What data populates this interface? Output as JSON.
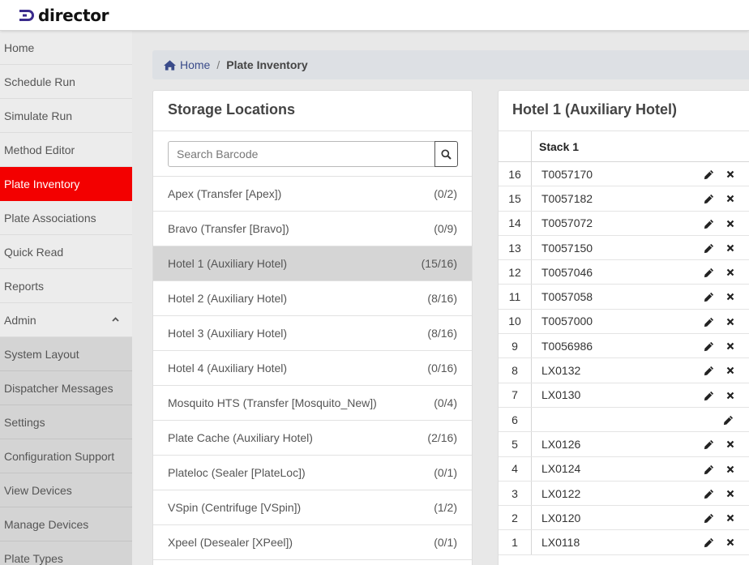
{
  "app": {
    "logo_text": "director"
  },
  "sidebar": {
    "items": [
      {
        "label": "Home",
        "state": "normal"
      },
      {
        "label": "Schedule Run",
        "state": "normal"
      },
      {
        "label": "Simulate Run",
        "state": "normal"
      },
      {
        "label": "Method Editor",
        "state": "normal"
      },
      {
        "label": "Plate Inventory",
        "state": "active"
      },
      {
        "label": "Plate Associations",
        "state": "normal"
      },
      {
        "label": "Quick Read",
        "state": "normal"
      },
      {
        "label": "Reports",
        "state": "normal"
      },
      {
        "label": "Admin",
        "state": "normal",
        "icon": "chevron-up-icon"
      },
      {
        "label": "System Layout",
        "state": "sub"
      },
      {
        "label": "Dispatcher Messages",
        "state": "sub"
      },
      {
        "label": "Settings",
        "state": "sub"
      },
      {
        "label": "Configuration Support",
        "state": "sub"
      },
      {
        "label": "View Devices",
        "state": "sub"
      },
      {
        "label": "Manage Devices",
        "state": "sub"
      },
      {
        "label": "Plate Types",
        "state": "sub"
      }
    ]
  },
  "breadcrumb": {
    "home_label": "Home",
    "separator": "/",
    "current": "Plate Inventory",
    "home_icon": "home-icon"
  },
  "storage": {
    "title": "Storage Locations",
    "search_placeholder": "Search Barcode",
    "search_value": "",
    "search_icon": "search-icon",
    "locations": [
      {
        "name": "Apex (Transfer [Apex])",
        "count": "(0/2)"
      },
      {
        "name": "Bravo (Transfer [Bravo])",
        "count": "(0/9)"
      },
      {
        "name": "Hotel 1 (Auxiliary Hotel)",
        "count": "(15/16)",
        "selected": true
      },
      {
        "name": "Hotel 2 (Auxiliary Hotel)",
        "count": "(8/16)"
      },
      {
        "name": "Hotel 3 (Auxiliary Hotel)",
        "count": "(8/16)"
      },
      {
        "name": "Hotel 4 (Auxiliary Hotel)",
        "count": "(0/16)"
      },
      {
        "name": "Mosquito HTS (Transfer [Mosquito_New])",
        "count": "(0/4)"
      },
      {
        "name": "Plate Cache (Auxiliary Hotel)",
        "count": "(2/16)"
      },
      {
        "name": "Plateloc (Sealer [PlateLoc])",
        "count": "(0/1)"
      },
      {
        "name": "VSpin (Centrifuge [VSpin])",
        "count": "(1/2)"
      },
      {
        "name": "Xpeel (Desealer [XPeel])",
        "count": "(0/1)"
      }
    ]
  },
  "hotel": {
    "title": "Hotel 1 (Auxiliary Hotel)",
    "stack_header": "Stack 1",
    "rows": [
      {
        "num": "16",
        "barcode": "T0057170"
      },
      {
        "num": "15",
        "barcode": "T0057182"
      },
      {
        "num": "14",
        "barcode": "T0057072"
      },
      {
        "num": "13",
        "barcode": "T0057150"
      },
      {
        "num": "12",
        "barcode": "T0057046"
      },
      {
        "num": "11",
        "barcode": "T0057058"
      },
      {
        "num": "10",
        "barcode": "T0057000"
      },
      {
        "num": "9",
        "barcode": "T0056986"
      },
      {
        "num": "8",
        "barcode": "LX0132"
      },
      {
        "num": "7",
        "barcode": "LX0130"
      },
      {
        "num": "6",
        "barcode": ""
      },
      {
        "num": "5",
        "barcode": "LX0126"
      },
      {
        "num": "4",
        "barcode": "LX0124"
      },
      {
        "num": "3",
        "barcode": "LX0122"
      },
      {
        "num": "2",
        "barcode": "LX0120"
      },
      {
        "num": "1",
        "barcode": "LX0118"
      }
    ]
  },
  "colors": {
    "active_nav": "#f30000",
    "brand_accent": "#3a2a8c",
    "breadcrumb_link": "#3a4b8a"
  }
}
